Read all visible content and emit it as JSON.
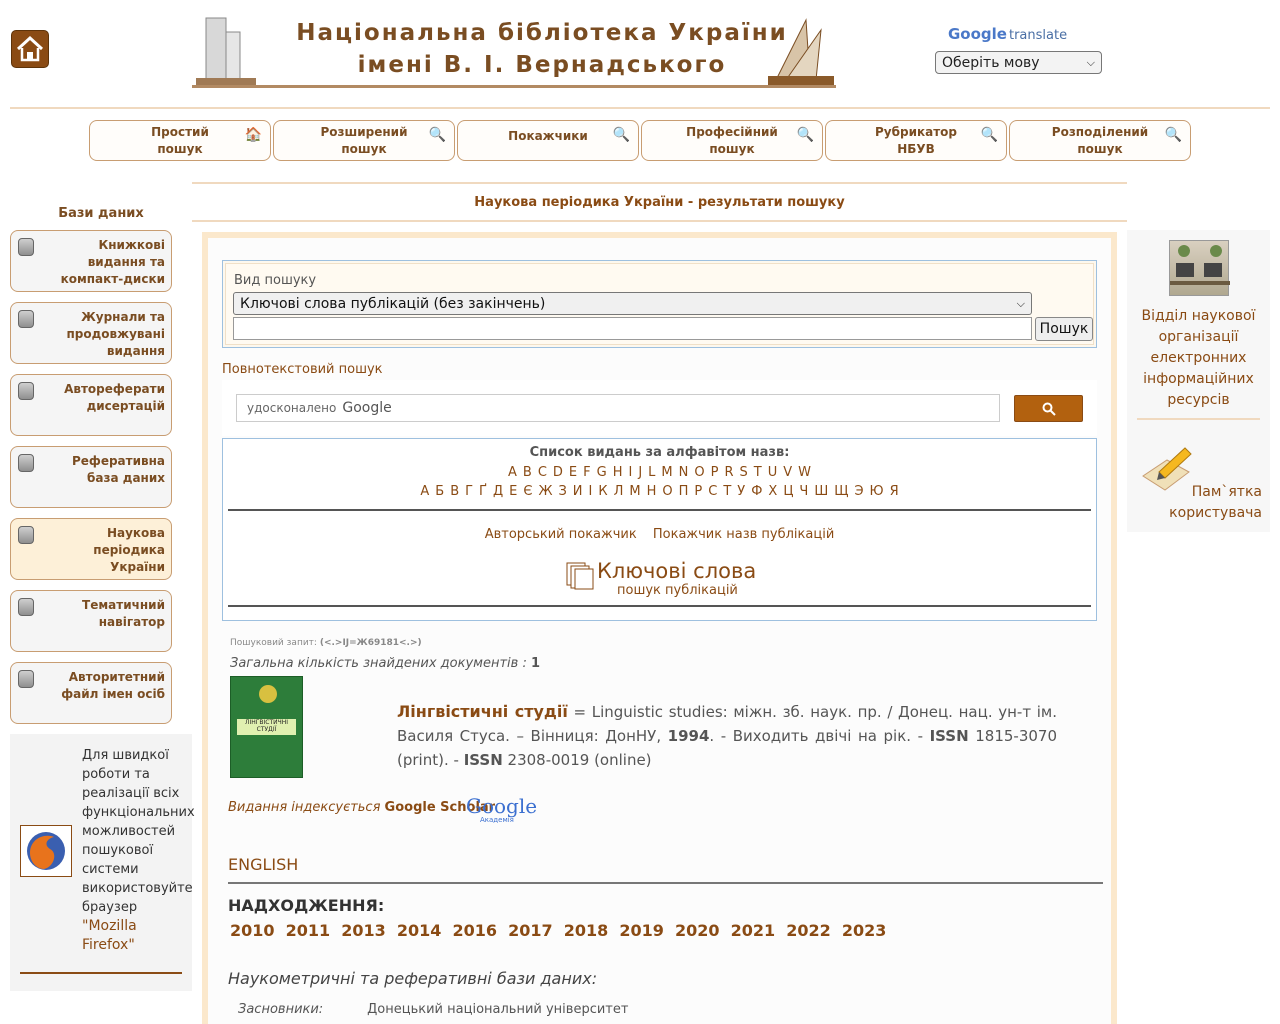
{
  "header": {
    "title_line1": "Національна бібліотека України",
    "title_line2": "імені В. І. Вернадського",
    "translate_google": "Google",
    "translate_label": "translate",
    "language_select": "Оберіть мову"
  },
  "nav": [
    {
      "line1": "Простий",
      "line2": "пошук",
      "icon": "home-search-icon"
    },
    {
      "line1": "Розширений",
      "line2": "пошук",
      "icon": "magnifier-icon"
    },
    {
      "line1": "Покажчики",
      "line2": "",
      "icon": "magnifier-icon"
    },
    {
      "line1": "Професійний",
      "line2": "пошук",
      "icon": "magnifier-icon"
    },
    {
      "line1": "Рубрикатор",
      "line2": "НБУВ",
      "icon": "magnifier-icon"
    },
    {
      "line1": "Розподілений",
      "line2": "пошук",
      "icon": "magnifier-icon"
    }
  ],
  "sidebar": {
    "title": "Бази даних",
    "items": [
      "Книжкові видання та компакт-диски",
      "Журнали та продовжувані видання",
      "Автореферати дисертацій",
      "Реферативна база даних",
      "Наукова періодика України",
      "Тематичний навігатор",
      "Авторитетний файл імен осіб"
    ],
    "firefox_text": "Для швидкої роботи та реалізації всіх функціональних можливостей пошукової системи використовуйте браузер",
    "firefox_link": "\"Mozilla Firefox\""
  },
  "results_title": "Наукова періодика України - результати пошуку",
  "search": {
    "type_label": "Вид пошуку",
    "type_value": "Ключові слова публікацій (без закінчень)",
    "query_value": "",
    "submit": "Пошук",
    "fulltext_label": "Повнотекстовий пошук",
    "gcs_prefix": "удосконалено",
    "gcs_google": "Google"
  },
  "alphabet": {
    "title": "Список видань за алфавітом назв:",
    "latin": [
      "A",
      "B",
      "C",
      "D",
      "E",
      "F",
      "G",
      "H",
      "I",
      "J",
      "L",
      "M",
      "N",
      "O",
      "P",
      "R",
      "S",
      "T",
      "U",
      "V",
      "W"
    ],
    "cyrillic": [
      "А",
      "Б",
      "В",
      "Г",
      "Ґ",
      "Д",
      "Е",
      "Є",
      "Ж",
      "З",
      "И",
      "І",
      "К",
      "Л",
      "М",
      "Н",
      "О",
      "П",
      "Р",
      "С",
      "Т",
      "У",
      "Ф",
      "Х",
      "Ц",
      "Ч",
      "Ш",
      "Щ",
      "Э",
      "Ю",
      "Я"
    ],
    "author_index": "Авторський покажчик",
    "title_index": "Покажчик назв публікацій",
    "keywords_title": "Ключові слова",
    "keywords_sub": "пошук публікацій"
  },
  "result": {
    "query_prefix": "Пошуковий запит:",
    "query": "(<.>IJ=Ж69181<.>)",
    "count_label": "Загальна кількість знайдених документів",
    "count_sep": ":",
    "count": "1",
    "cover_text": "ЛІНГВІСТИЧНІ СТУДІЇ",
    "name": "Лінгвістичні студії",
    "desc1": "= Linguistic studies: міжн. зб. наук. пр. / Донец. нац. ун-т ім. Василя Стуса. – Вінниця: ДонНУ,",
    "year": "1994",
    "desc2": ". - Виходить двічі на рік. -",
    "issn_label": "ISSN",
    "issn_print": "1815-3070 (print). -",
    "issn_online": "2308-0019 (online)"
  },
  "scholar": {
    "prefix": "Видання індексується",
    "name": "Google Scholar",
    "logo_text": "Google",
    "logo_sub": "Академія"
  },
  "english_link": "ENGLISH",
  "arrivals": {
    "title": "НАДХОДЖЕННЯ:",
    "years": [
      "2010",
      "2011",
      "2013",
      "2014",
      "2016",
      "2017",
      "2018",
      "2019",
      "2020",
      "2021",
      "2022",
      "2023"
    ]
  },
  "ref_title": "Наукометричні та реферативні бази даних:",
  "founders": {
    "label": "Засновники:",
    "value": "Донецький національний університет"
  },
  "right": {
    "dept": "Відділ наукової організації електронних інформаційних ресурсів",
    "memo": "Пам`ятка користувача"
  },
  "colors": {
    "accent": "#8a4b14",
    "border": "#c89d72",
    "box_border": "#9ec0df"
  }
}
